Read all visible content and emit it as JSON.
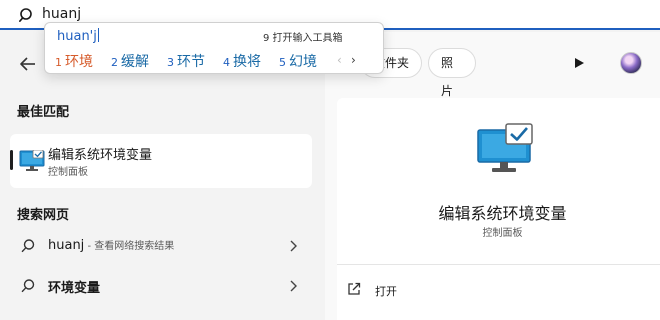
{
  "search": {
    "query": "huanj"
  },
  "ime": {
    "composition": "huan'j",
    "toolbox_label": "9 打开输入工具箱",
    "candidates": [
      {
        "index": "1",
        "text": "环境"
      },
      {
        "index": "2",
        "text": "缓解"
      },
      {
        "index": "3",
        "text": "环节"
      },
      {
        "index": "4",
        "text": "换将"
      },
      {
        "index": "5",
        "text": "幻境"
      }
    ],
    "prev_glyph": "‹",
    "next_glyph": "›"
  },
  "filters": {
    "folders_label": "文件夹",
    "photos_label": "照片"
  },
  "left": {
    "best_match_title": "最佳匹配",
    "best": {
      "title": "编辑系统环境变量",
      "subtitle": "控制面板"
    },
    "web_title": "搜索网页",
    "web_rows": [
      {
        "main": "huanj",
        "suffix": " - 查看网络搜索结果"
      },
      {
        "main": "环境变量",
        "suffix": ""
      }
    ]
  },
  "right": {
    "title": "编辑系统环境变量",
    "subtitle": "控制面板",
    "open_label": "打开"
  },
  "icons": {
    "search": "search-icon",
    "back": "back-arrow-icon",
    "monitor": "monitor-check-icon",
    "chevron": "chevron-right-icon",
    "open": "open-external-icon",
    "play": "play-icon",
    "avatar": "user-avatar"
  }
}
